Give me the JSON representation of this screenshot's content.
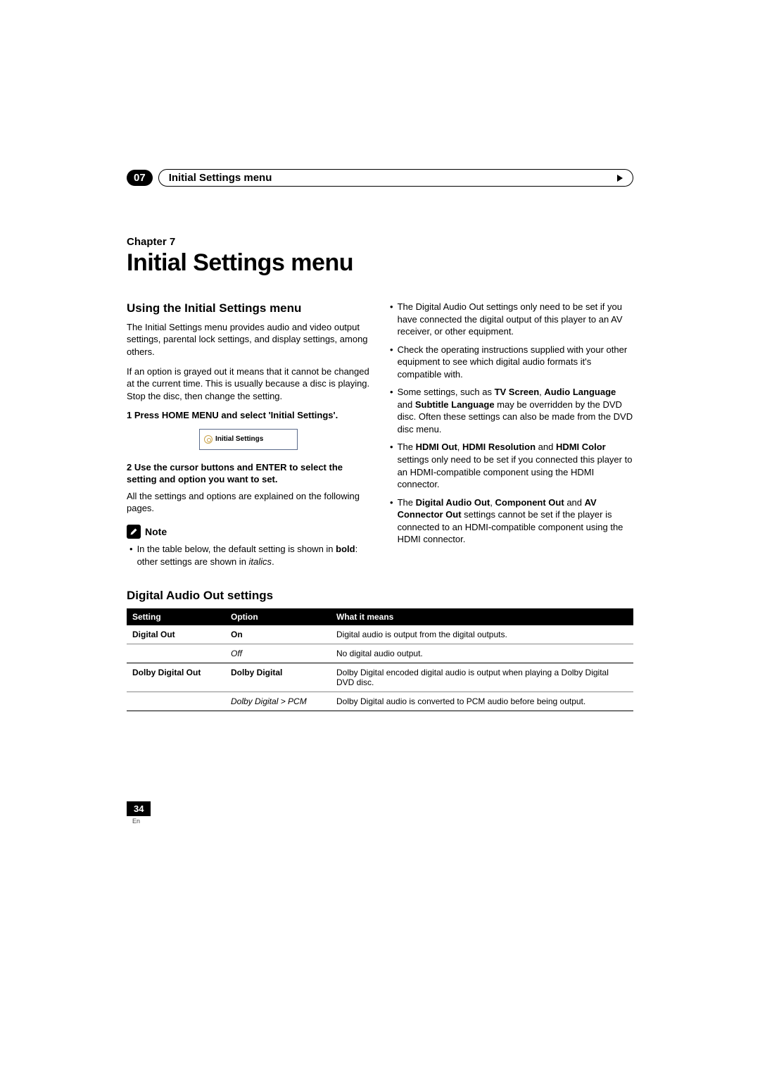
{
  "header": {
    "chapter_num": "07",
    "title": "Initial Settings menu"
  },
  "chapter": {
    "label": "Chapter 7",
    "h1": "Initial Settings menu"
  },
  "left": {
    "h2": "Using the Initial Settings menu",
    "p1": "The Initial Settings menu provides audio and video output settings, parental lock settings, and display settings, among others.",
    "p2": "If an option is grayed out it means that it cannot be changed at the current time. This is usually because a disc is playing. Stop the disc, then change the setting.",
    "step1": "1   Press HOME MENU and select 'Initial Settings'.",
    "screenshot_label": "Initial Settings",
    "step2": "2   Use the cursor buttons and ENTER to select the setting and option you want to set.",
    "p3": "All the settings and options are explained on the following pages.",
    "note_title": "Note",
    "note_text_pre": "In the table below, the default setting is shown in ",
    "note_bold": "bold",
    "note_text_mid": ": other settings are shown in ",
    "note_italic": "italics",
    "note_text_post": "."
  },
  "right": {
    "b1": "The Digital Audio Out settings only need to be set if you have connected the digital output of this player to an AV receiver, or other equipment.",
    "b2": "Check the operating instructions supplied with your other equipment to see which digital audio formats it's compatible with.",
    "b3_pre": "Some settings, such as ",
    "b3_bold1": "TV Screen",
    "b3_sep1": ", ",
    "b3_bold2": "Audio Language",
    "b3_sep2": " and ",
    "b3_bold3": "Subtitle Language",
    "b3_post": " may be overridden by the DVD disc. Often these settings can also be made from the DVD disc menu.",
    "b4_pre": "The ",
    "b4_bold1": "HDMI Out",
    "b4_sep1": ", ",
    "b4_bold2": "HDMI Resolution",
    "b4_sep2": " and ",
    "b4_bold3": "HDMI Color",
    "b4_post": " settings only need to be set if you connected this player to an HDMI-compatible component using the HDMI connector.",
    "b5_pre": "The ",
    "b5_bold1": "Digital Audio Out",
    "b5_sep1": ", ",
    "b5_bold2": "Component Out",
    "b5_sep2": " and ",
    "b5_bold3": "AV Connector Out",
    "b5_post": " settings cannot be set if the player is connected to an HDMI-compatible component using the HDMI connector."
  },
  "table": {
    "h2": "Digital Audio Out settings",
    "headers": {
      "c1": "Setting",
      "c2": "Option",
      "c3": "What it means"
    },
    "rows": [
      {
        "setting": "Digital Out",
        "option": "On",
        "option_style": "bold",
        "meaning": "Digital audio is output from the digital outputs."
      },
      {
        "setting": "",
        "option": "Off",
        "option_style": "italic",
        "meaning": "No digital audio output."
      },
      {
        "setting": "Dolby Digital Out",
        "option": "Dolby Digital",
        "option_style": "bold",
        "meaning": "Dolby Digital encoded digital audio is output when playing a Dolby Digital DVD disc."
      },
      {
        "setting": "",
        "option": "Dolby Digital > PCM",
        "option_style": "italic",
        "meaning": "Dolby Digital audio is converted to PCM audio before being output."
      }
    ]
  },
  "footer": {
    "page": "34",
    "lang": "En"
  }
}
